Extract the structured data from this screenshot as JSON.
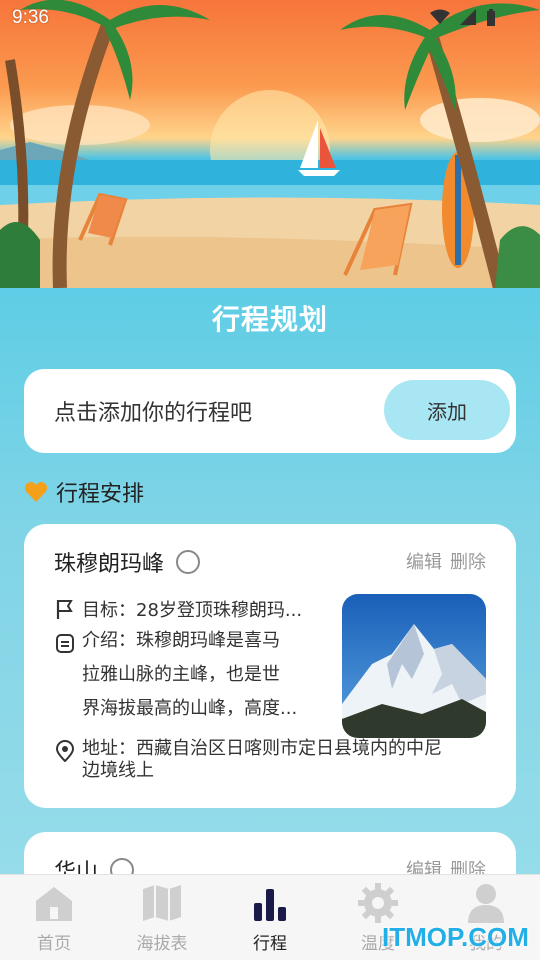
{
  "status_bar": {
    "time": "9:36"
  },
  "page": {
    "title": "行程规划"
  },
  "add_box": {
    "hint": "点击添加你的行程吧",
    "button_label": "添加"
  },
  "section": {
    "title": "行程安排",
    "icon": "heart-icon",
    "icon_color": "#f5a01a"
  },
  "cards": [
    {
      "title": "珠穆朗玛峰",
      "edit_label": "编辑",
      "delete_label": "删除",
      "goal": "目标：28岁登顶珠穆朗玛...",
      "intro_lines": [
        "介绍：珠穆朗玛峰是喜马",
        "拉雅山脉的主峰，也是世",
        "界海拔最高的山峰，高度..."
      ],
      "address_lines": [
        "地址：西藏自治区日喀则市定日县境内的中尼",
        "边境线上"
      ],
      "photo": "snowy-mountain-photo"
    },
    {
      "title": "华山",
      "edit_label": "编辑",
      "delete_label": "删除"
    }
  ],
  "tabbar": {
    "tabs": [
      {
        "label": "首页",
        "icon": "home-icon",
        "active": false
      },
      {
        "label": "海拔表",
        "icon": "map-icon",
        "active": false
      },
      {
        "label": "行程",
        "icon": "bar-chart-icon",
        "active": true
      },
      {
        "label": "温度",
        "icon": "gear-icon",
        "active": false
      },
      {
        "label": "我的",
        "icon": "user-icon",
        "active": false
      }
    ]
  },
  "watermark": "ITMOP.COM",
  "colors": {
    "accent": "#5ecde5",
    "add_button": "#a9e6f3",
    "active_tab": "#1a1a4a"
  }
}
